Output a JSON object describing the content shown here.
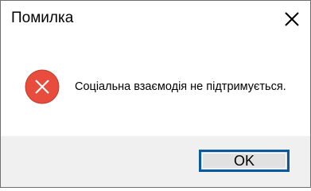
{
  "dialog": {
    "title": "Помилка",
    "close_icon": "close-icon",
    "error_icon": "error-x-icon",
    "message": "Соціальна взаємодія не підтримується.",
    "ok_label": "OK"
  },
  "colors": {
    "error_red": "#e74c3c",
    "button_border": "#0b5a9e",
    "footer_bg": "#f0f0f0"
  }
}
